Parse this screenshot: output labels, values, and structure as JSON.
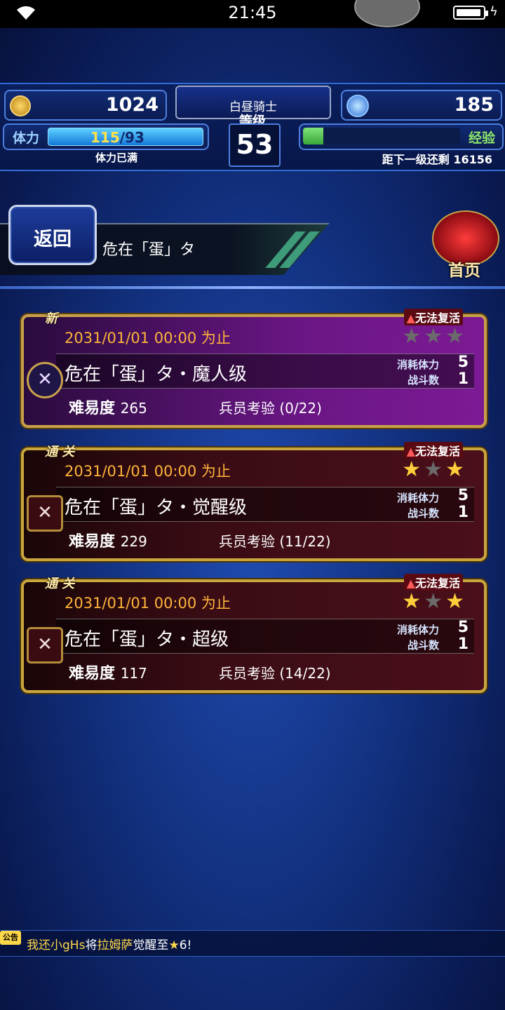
{
  "status_bar": {
    "time": "21:45"
  },
  "hud": {
    "gil": "1024",
    "gems": "185",
    "job": "白昼骑士",
    "level_label": "等级",
    "level": "53",
    "stamina_label": "体力",
    "stamina_current": "115",
    "stamina_max": "/93",
    "stamina_fraction": 1.0,
    "stamina_note": "体力已满",
    "exp_label": "经验",
    "exp_fraction": 0.13,
    "exp_note": "距下一级还剩 16156"
  },
  "header": {
    "back_label": "返回",
    "title": "危在「蛋」タ",
    "home_label": "首页"
  },
  "quests": [
    {
      "tag": "新",
      "warning": "无法复活",
      "deadline": "2031/01/01 00:00  为止",
      "stars": [
        false,
        false,
        false
      ],
      "name": "危在「蛋」タ・魔人级",
      "cost_label": "消耗体力",
      "cost": "5",
      "battles_label": "战斗数",
      "battles": "1",
      "difficulty_label": "难易度",
      "difficulty": "265",
      "trial": "兵员考验 (0/22)"
    },
    {
      "tag": "通 关",
      "warning": "无法复活",
      "deadline": "2031/01/01 00:00  为止",
      "stars": [
        true,
        false,
        true
      ],
      "name": "危在「蛋」タ・觉醒级",
      "cost_label": "消耗体力",
      "cost": "5",
      "battles_label": "战斗数",
      "battles": "1",
      "difficulty_label": "难易度",
      "difficulty": "229",
      "trial": "兵员考验 (11/22)"
    },
    {
      "tag": "通 关",
      "warning": "无法复活",
      "deadline": "2031/01/01 00:00  为止",
      "stars": [
        true,
        false,
        true
      ],
      "name": "危在「蛋」タ・超级",
      "cost_label": "消耗体力",
      "cost": "5",
      "battles_label": "战斗数",
      "battles": "1",
      "difficulty_label": "难易度",
      "difficulty": "117",
      "trial": "兵员考验 (14/22)"
    }
  ],
  "ticker": {
    "badge": "公告",
    "user": "我还小gHs",
    "verb1": "将",
    "unit": "拉姆萨",
    "verb2": "觉醒至",
    "star": "★",
    "rank": "6!"
  }
}
